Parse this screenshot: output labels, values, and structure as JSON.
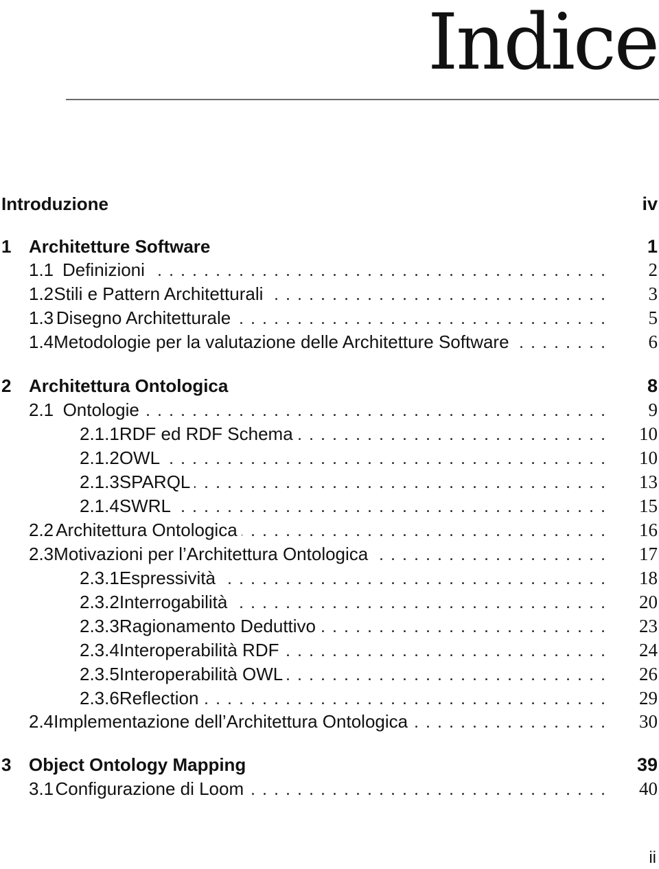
{
  "page": {
    "title": "Indice",
    "folio": "ii"
  },
  "toc": [
    {
      "level": "chapter",
      "number": "",
      "title": "Introduzione",
      "page": "iv",
      "leader": false
    },
    {
      "level": "chapter",
      "number": "1",
      "title": "Architetture Software",
      "page": "1",
      "leader": false
    },
    {
      "level": "sec",
      "number": "1.1",
      "title": "Definizioni",
      "page": "2",
      "leader": true
    },
    {
      "level": "sec",
      "number": "1.2",
      "title": "Stili e Pattern Architetturali",
      "page": "3",
      "leader": true
    },
    {
      "level": "sec",
      "number": "1.3",
      "title": "Disegno Architetturale",
      "page": "5",
      "leader": true
    },
    {
      "level": "sec",
      "number": "1.4",
      "title": "Metodologie per la valutazione delle Architetture Software",
      "page": "6",
      "leader": true
    },
    {
      "level": "chapter",
      "number": "2",
      "title": "Architettura Ontologica",
      "page": "8",
      "leader": false
    },
    {
      "level": "sec",
      "number": "2.1",
      "title": "Ontologie",
      "page": "9",
      "leader": true
    },
    {
      "level": "subsec",
      "number": "2.1.1",
      "title": "RDF ed RDF Schema",
      "page": "10",
      "leader": true
    },
    {
      "level": "subsec",
      "number": "2.1.2",
      "title": "OWL",
      "page": "10",
      "leader": true
    },
    {
      "level": "subsec",
      "number": "2.1.3",
      "title": "SPARQL",
      "page": "13",
      "leader": true
    },
    {
      "level": "subsec",
      "number": "2.1.4",
      "title": "SWRL",
      "page": "15",
      "leader": true
    },
    {
      "level": "sec",
      "number": "2.2",
      "title": "Architettura Ontologica",
      "page": "16",
      "leader": true
    },
    {
      "level": "sec",
      "number": "2.3",
      "title": "Motivazioni per l’Architettura Ontologica",
      "page": "17",
      "leader": true
    },
    {
      "level": "subsec",
      "number": "2.3.1",
      "title": "Espressività",
      "page": "18",
      "leader": true
    },
    {
      "level": "subsec",
      "number": "2.3.2",
      "title": "Interrogabilità",
      "page": "20",
      "leader": true
    },
    {
      "level": "subsec",
      "number": "2.3.3",
      "title": "Ragionamento Deduttivo",
      "page": "23",
      "leader": true
    },
    {
      "level": "subsec",
      "number": "2.3.4",
      "title": "Interoperabilità RDF",
      "page": "24",
      "leader": true
    },
    {
      "level": "subsec",
      "number": "2.3.5",
      "title": "Interoperabilità OWL",
      "page": "26",
      "leader": true
    },
    {
      "level": "subsec",
      "number": "2.3.6",
      "title": "Reflection",
      "page": "29",
      "leader": true
    },
    {
      "level": "sec",
      "number": "2.4",
      "title": "Implementazione dell’Architettura Ontologica",
      "page": "30",
      "leader": true
    },
    {
      "level": "chapter",
      "number": "3",
      "title": "Object Ontology Mapping",
      "page": "39",
      "leader": false
    },
    {
      "level": "sec",
      "number": "3.1",
      "title": "Configurazione di Loom",
      "page": "40",
      "leader": true
    }
  ]
}
